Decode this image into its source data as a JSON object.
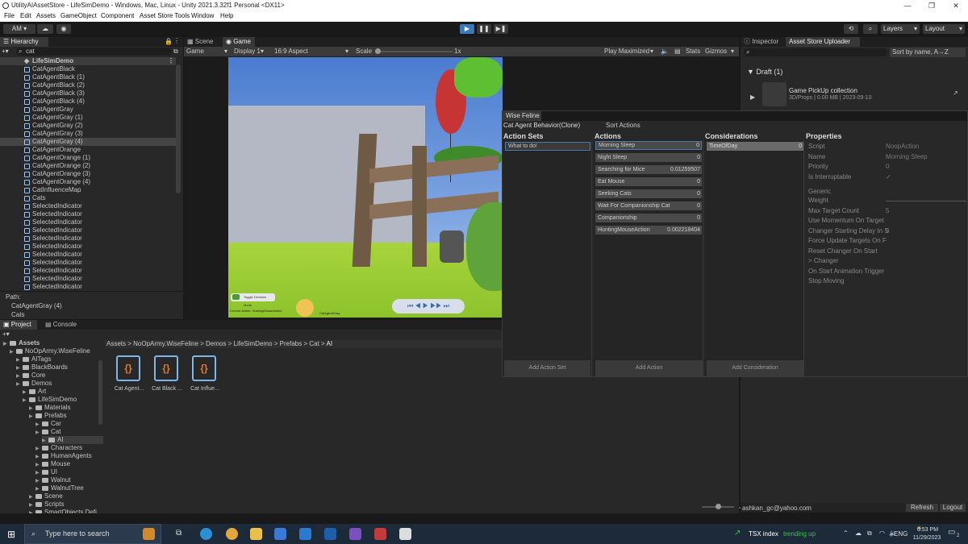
{
  "window": {
    "title": "UtilityAIAssetStore - LifeSimDemo - Windows, Mac, Linux - Unity 2021.3.32f1 Personal <DX11>"
  },
  "menu": [
    "File",
    "Edit",
    "Assets",
    "GameObject",
    "Component",
    "Asset Store Tools",
    "Window",
    "Help"
  ],
  "toolbar": {
    "account": "AM",
    "layers": "Layers",
    "layout": "Layout"
  },
  "hierarchy": {
    "tab": "Hierarchy",
    "search": "cat",
    "root": "LifeSimDemo",
    "items": [
      "CatAgentBlack",
      "CatAgentBlack (1)",
      "CatAgentBlack (2)",
      "CatAgentBlack (3)",
      "CatAgentBlack (4)",
      "CatAgentGray",
      "CatAgentGray (1)",
      "CatAgentGray (2)",
      "CatAgentGray (3)",
      "CatAgentGray (4)",
      "CatAgentOrange",
      "CatAgentOrange (1)",
      "CatAgentOrange (2)",
      "CatAgentOrange (3)",
      "CatAgentOrange (4)",
      "CatInfluenceMap",
      "Cats",
      "SelectedIndicator",
      "SelectedIndicator",
      "SelectedIndicator",
      "SelectedIndicator",
      "SelectedIndicator",
      "SelectedIndicator",
      "SelectedIndicator",
      "SelectedIndicator",
      "SelectedIndicator",
      "SelectedIndicator",
      "SelectedIndicator"
    ],
    "selected_index": 9,
    "path_label": "Path:",
    "path": [
      "CatAgentGray (4)",
      "Cats"
    ]
  },
  "game": {
    "tab_scene": "Scene",
    "tab_game": "Game",
    "view": "Game",
    "display": "Display 1",
    "aspect": "16:9 Aspect",
    "scale_label": "Scale",
    "scale_value": "1x",
    "play_mode": "Play Maximized",
    "stats": "Stats",
    "gizmos": "Gizmos",
    "hud_left": "Current Action: HuntingMouseAction",
    "hud_mid": "CatAgentGray",
    "hud_small": "Toggle Decision Mode"
  },
  "inspector": {
    "tab": "Inspector",
    "tab2": "Asset Store Uploader",
    "sort": "Sort by name, A→Z",
    "draft": "Draft (1)",
    "item_title": "Game PickUp collection",
    "item_meta": "3D/Props | 0.00 MB | 2023-09-10",
    "email": "ashkan_gc@yahoo.com",
    "refresh": "Refresh",
    "logout": "Logout"
  },
  "wise": {
    "title": "Wise Feline",
    "object": "Cat Agent Behavior(Clone)",
    "sort_actions": "Sort Actions",
    "h_action_sets": "Action Sets",
    "h_actions": "Actions",
    "h_considerations": "Considerations",
    "h_properties": "Properties",
    "action_set": "What to do!",
    "actions": [
      {
        "name": "Morning Sleep",
        "value": "0"
      },
      {
        "name": "Night Sleep",
        "value": "0"
      },
      {
        "name": "Searching for Mice",
        "value": "0.01259507"
      },
      {
        "name": "Eat Mouse",
        "value": "0"
      },
      {
        "name": "Seeking Cats",
        "value": "0"
      },
      {
        "name": "Wait For Companionship Cat",
        "value": "0"
      },
      {
        "name": "Companionship",
        "value": "0"
      },
      {
        "name": "HuntingMouseAction",
        "value": "0.002218404"
      }
    ],
    "consideration": {
      "name": "TimeOfDay",
      "value": "0"
    },
    "add_action_set": "Add Action Set",
    "add_action": "Add Action",
    "add_consideration": "Add Consideration",
    "properties": [
      {
        "label": "Script",
        "value": "NoopAction"
      },
      {
        "label": "Name",
        "value": "Morning Sleep"
      },
      {
        "label": "Priority",
        "value": "0"
      },
      {
        "label": "Is Interruptable",
        "value": "✓"
      }
    ],
    "generic_label": "Generic",
    "generic": [
      {
        "label": "Weight",
        "value": ""
      },
      {
        "label": "Max Target Count",
        "value": "5"
      },
      {
        "label": "Use Momentum On Target",
        "value": ""
      },
      {
        "label": "Changer Starting Delay In S",
        "value": "0"
      },
      {
        "label": "Force Update Targets On F",
        "value": ""
      },
      {
        "label": "Reset Changer On Start",
        "value": ""
      },
      {
        "label": "> Changer",
        "value": ""
      },
      {
        "label": "On Start Animation Trigger",
        "value": ""
      },
      {
        "label": "Stop Moving",
        "value": ""
      }
    ]
  },
  "project": {
    "tab": "Project",
    "tab2": "Console",
    "breadcrumb": [
      "Assets",
      "NoOpArmy.WiseFeline",
      "Demos",
      "LifeSimDemo",
      "Prefabs",
      "Cat",
      "AI"
    ],
    "tree": [
      {
        "label": "Assets",
        "indent": 0,
        "bold": true
      },
      {
        "label": "NoOpArmy.WiseFeline",
        "indent": 1
      },
      {
        "label": "AITags",
        "indent": 2
      },
      {
        "label": "BlackBoards",
        "indent": 2
      },
      {
        "label": "Core",
        "indent": 2
      },
      {
        "label": "Demos",
        "indent": 2
      },
      {
        "label": "Art",
        "indent": 3
      },
      {
        "label": "LifeSimDemo",
        "indent": 3
      },
      {
        "label": "Materials",
        "indent": 4
      },
      {
        "label": "Prefabs",
        "indent": 4
      },
      {
        "label": "Car",
        "indent": 5
      },
      {
        "label": "Cat",
        "indent": 5
      },
      {
        "label": "AI",
        "indent": 6
      },
      {
        "label": "Characters",
        "indent": 5
      },
      {
        "label": "HumanAgents",
        "indent": 5
      },
      {
        "label": "Mouse",
        "indent": 5
      },
      {
        "label": "UI",
        "indent": 5
      },
      {
        "label": "Walnut",
        "indent": 5
      },
      {
        "label": "WalnutTree",
        "indent": 5
      },
      {
        "label": "Scene",
        "indent": 4
      },
      {
        "label": "Scripts",
        "indent": 4
      },
      {
        "label": "SmartObjects Defi...",
        "indent": 4
      }
    ],
    "assets": [
      "Cat Agent...",
      "Cat Black ...",
      "Cat Influe..."
    ]
  },
  "taskbar": {
    "search": "Type here to search",
    "tsx_label": "TSX index",
    "tsx_status": "trending up",
    "lang": "ENG",
    "time": "6:53 PM",
    "date": "11/29/2023",
    "notif": "2"
  }
}
